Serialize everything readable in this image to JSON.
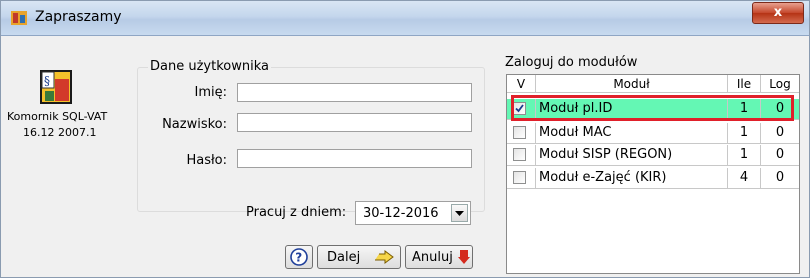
{
  "window": {
    "title": "Zapraszamy",
    "close_label": "x"
  },
  "app": {
    "name": "Komornik SQL-VAT",
    "version": "16.12 2007.1"
  },
  "user_group": {
    "title": "Dane użytkownika",
    "first_name_label": "Imię:",
    "first_name_value": "",
    "last_name_label": "Nazwisko:",
    "last_name_value": "",
    "password_label": "Hasło:",
    "password_value": ""
  },
  "date": {
    "label": "Pracuj z dniem:",
    "value": "30-12-2016"
  },
  "buttons": {
    "next_label": "Dalej",
    "cancel_label": "Anuluj"
  },
  "modules": {
    "title": "Zaloguj do modułów",
    "headers": {
      "check": "V",
      "module": "Moduł",
      "count": "Ile",
      "log": "Log"
    },
    "rows": [
      {
        "name": "Moduł pl.ID",
        "count": "1",
        "log": "0",
        "checked": true,
        "selected": true
      },
      {
        "name": "Moduł MAC",
        "count": "1",
        "log": "0",
        "checked": false,
        "selected": false
      },
      {
        "name": "Moduł SISP (REGON)",
        "count": "1",
        "log": "0",
        "checked": false,
        "selected": false
      },
      {
        "name": "Moduł e-Zajęć (KIR)",
        "count": "4",
        "log": "0",
        "checked": false,
        "selected": false
      }
    ]
  },
  "colors": {
    "selected_row": "#64f7b4",
    "highlight": "#e0202a",
    "title_gradient": "#c4d6ec"
  },
  "icons": [
    "app-icon",
    "logo-icon",
    "help-icon",
    "next-arrow-icon",
    "cancel-icon",
    "dropdown-arrow-icon",
    "checkbox-icon"
  ]
}
